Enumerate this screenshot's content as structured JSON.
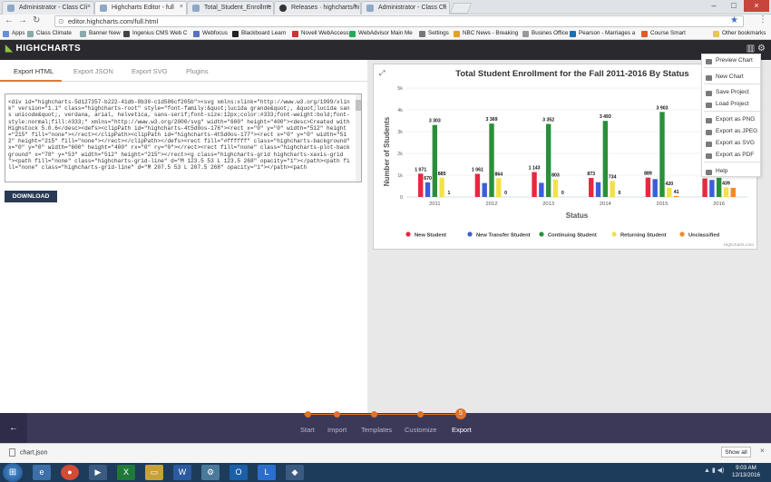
{
  "browser": {
    "tabs": [
      {
        "title": "Administrator - Class Cli",
        "active": false
      },
      {
        "title": "Highcharts Editor - full",
        "active": true
      },
      {
        "title": "Total_Student_Enrollme",
        "active": false
      },
      {
        "title": "Releases · highcharts/hi",
        "active": false
      },
      {
        "title": "Administrator - Class Cli",
        "active": false
      }
    ],
    "url": "editor.highcharts.com/full.html",
    "bookmarks": [
      "Apps",
      "Class Climate",
      "Banner New",
      "Ingenius CMS Web C",
      "Webfocus",
      "Blackboard Learn",
      "Novell WebAccess",
      "WebAdvisor Main Me",
      "Settings",
      "NBC News - Breaking",
      "Busines Office",
      "Pearson - Marriages a",
      "Course Smart",
      "Other bookmarks"
    ]
  },
  "app": {
    "logo": "HIGHCHARTS",
    "export_tabs": [
      "Export HTML",
      "Export JSON",
      "Export SVG",
      "Plugins"
    ],
    "code_text": "<div id=\"highcharts-5d127357-b222-41db-8b30-c1d586cf205b\"><svg xmlns:xlink=\"http://www.w3.org/1999/xlink\" version=\"1.1\" class=\"highcharts-root\" style=\"font-family:&quot;lucida grande&quot;, &quot;lucida sans unicode&quot;, verdana, arial, helvetica, sans-serif;font-size:12px;color:#333;font-weight:bold;font-style:normal;fill:#333;\" xmlns=\"http://www.w3.org/2000/svg\" width=\"600\" height=\"400\"><desc>Created with Highstock 5.0.6</desc><defs><clipPath id=\"highcharts-4t5d0os-176\"><rect x=\"0\" y=\"0\" width=\"512\" height=\"215\" fill=\"none\"></rect></clipPath><clipPath id=\"highcharts-4t5d0os-177\"><rect x=\"0\" y=\"0\" width=\"512\" height=\"215\" fill=\"none\"></rect></clipPath></defs><rect fill=\"#ffffff\" class=\"highcharts-background\" x=\"0\" y=\"0\" width=\"600\" height=\"400\" rx=\"0\" ry=\"0\"></rect><rect fill=\"none\" class=\"highcharts-plot-background\" x=\"78\" y=\"53\" width=\"512\" height=\"215\"></rect><g class=\"highcharts-grid highcharts-xaxis-grid \"><path fill=\"none\" class=\"highcharts-grid-line\" d=\"M 123.5 53 L 123.5 268\" opacity=\"1\"></path><path fill=\"none\" class=\"highcharts-grid-line\" d=\"M 207.5 53 L 207.5 268\" opacity=\"1\"></path><path",
    "download_label": "DOWNLOAD",
    "context_menu": [
      "Preview Chart",
      "New Chart",
      "Save Project",
      "Load Project",
      "Export as PNG",
      "Export as JPEG",
      "Export as SVG",
      "Export as PDF",
      "Help"
    ],
    "steps": [
      {
        "num": "1",
        "label": "Start"
      },
      {
        "num": "2",
        "label": "Import"
      },
      {
        "num": "3",
        "label": "Templates"
      },
      {
        "num": "4",
        "label": "Customize"
      },
      {
        "num": "5",
        "label": "Export"
      }
    ],
    "active_step": 4
  },
  "downloads": {
    "file": "chart.json",
    "show_all": "Show all"
  },
  "taskbar": {
    "time": "9:03 AM",
    "date": "12/13/2016"
  },
  "chart_data": {
    "type": "bar",
    "title": "Total Student Enrollment for the Fall 2011-2016 By Status",
    "xlabel": "Status",
    "ylabel": "Number of Students",
    "ylim": [
      0,
      5000
    ],
    "yticks": [
      "0",
      "1k",
      "2k",
      "3k",
      "4k",
      "5k"
    ],
    "categories": [
      "2011",
      "2012",
      "2013",
      "2014",
      "2015",
      "2016"
    ],
    "credits": "Highcharts.com",
    "legend_position": "bottom",
    "series": [
      {
        "name": "New Student",
        "color": "#e8283f",
        "values": [
          1071,
          1061,
          1143,
          873,
          889,
          850
        ],
        "labels": [
          "1 071",
          "1 061",
          "1 143",
          "873",
          "889",
          ""
        ]
      },
      {
        "name": "New Transfer Student",
        "color": "#3a5fd8",
        "values": [
          670,
          640,
          650,
          680,
          820,
          780
        ],
        "labels": [
          "670",
          "",
          "",
          "",
          "",
          ""
        ]
      },
      {
        "name": "Continuing Student",
        "color": "#2a8f3a",
        "values": [
          3303,
          3369,
          3352,
          3493,
          3903,
          880
        ],
        "labels": [
          "3 303",
          "3 369",
          "3 352",
          "3 493",
          "3 903",
          ""
        ]
      },
      {
        "name": "Returning Student",
        "color": "#f4e04a",
        "values": [
          885,
          864,
          803,
          734,
          420,
          439
        ],
        "labels": [
          "885",
          "864",
          "803",
          "734",
          "420",
          "439"
        ]
      },
      {
        "name": "Unclassified",
        "color": "#f08a24",
        "values": [
          1,
          0,
          0,
          0,
          41,
          420
        ],
        "labels": [
          "1",
          "0",
          "0",
          "0",
          "41",
          ""
        ]
      }
    ]
  }
}
